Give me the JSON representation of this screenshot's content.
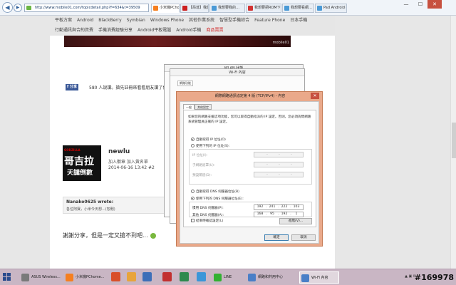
{
  "browser": {
    "url": "http://www.mobile01.com/topicdetail.php?f=634&t=39509",
    "back_glyph": "◀",
    "forward_glyph": "▶",
    "tabs": [
      {
        "label": "小米機PChome生…",
        "color": "#f57f20",
        "active": true
      },
      {
        "label": "【昂達】我能…",
        "color": "#cc2020",
        "active": false
      },
      {
        "label": "我想要我的…",
        "color": "#4a9ad6",
        "active": false
      },
      {
        "label": "我想要把ROM下…",
        "color": "#d23232",
        "active": false
      },
      {
        "label": "我想要看網…",
        "color": "#4a9ad6",
        "active": false
      },
      {
        "label": "Pad Android 點…",
        "color": "#4a9ad6",
        "active": false
      }
    ],
    "minimize": "—",
    "maximize": "☐",
    "close": "✕"
  },
  "site": {
    "menu_row1": [
      "平板方案",
      "Android",
      "BlackBerry",
      "Symbian",
      "Windows Phone",
      "其他作業系統",
      "智慧型手機綜合",
      "Feature Phone",
      "日本手機"
    ],
    "menu_row2": [
      "行動通訊與合約資費",
      "手機消費經驗分享",
      "Android平板電腦",
      "Android手機",
      "商品賣賣"
    ],
    "banner_caption": "mobile01",
    "fb_label": "f 分享",
    "fb_text": "580 人說讚。搶先註冊來看看朋友讚了什麼。",
    "post": {
      "avatar_small": "GODZILLA",
      "avatar_big": "哥吉拉",
      "avatar_sub": "天譴倒數",
      "username": "newlu",
      "meta": "加入徽章   加入黃名單",
      "date": "2014-06-16 13:42   #2"
    },
    "quote": {
      "author": "Nanako0625 wrote:",
      "text": "各位阿寶，小米今天想...(恕刪)"
    },
    "reply": "謝謝分享，但是一定又搶不到吧..."
  },
  "dialogs": {
    "bg_back_title": "WLAN 狀態",
    "wifi_title": "Wi-Fi 內容",
    "wifi_tab": "網路功能",
    "main": {
      "title": "網際網路通訊協定第 4 版 (TCP/IPv4) - 內容",
      "close": "✕",
      "tab_general": "一般",
      "tab_alternate": "其他設定",
      "description": "如果您的網路支援這項功能，您可以取得自動指派的 IP 設定。否則，您必須詢問網路系統管理員正確的 IP 設定。",
      "auto_ip": "自動取得 IP 位址(O)",
      "manual_ip": "使用下列的 IP 位址(S):",
      "ip_label": "IP 位址(I):",
      "subnet_label": "子網路遮罩(U):",
      "gateway_label": "預設閘道(D):",
      "auto_dns": "自動取得 DNS 伺服器位址(B)",
      "manual_dns": "使用下列的 DNS 伺服器位址(E):",
      "preferred_dns_label": "慣用 DNS 伺服器(P):",
      "preferred_dns": [
        "192",
        "241",
        "222",
        "103"
      ],
      "alternate_dns_label": "其他 DNS 伺服器(A):",
      "alternate_dns": [
        "168",
        "95",
        "192",
        "1"
      ],
      "validate_label": "結束時確認設定(L)",
      "advanced_button": "進階(V)...",
      "ok_button": "確定",
      "cancel_button": "取消"
    }
  },
  "taskbar": {
    "items": [
      {
        "label": "ASUS Wireless...",
        "color": "#7a7a7a",
        "active": false
      },
      {
        "label": "小米機PChome...",
        "color": "#f57f20",
        "active": false
      },
      {
        "label": "",
        "color": "#d94f2a",
        "active": false
      },
      {
        "label": "",
        "color": "#e8a43a",
        "active": false
      },
      {
        "label": "",
        "color": "#3d6fb8",
        "active": false
      },
      {
        "label": "",
        "color": "#c23030",
        "active": false
      },
      {
        "label": "",
        "color": "#2d8a4e",
        "active": false
      },
      {
        "label": "",
        "color": "#3a96d8",
        "active": false
      },
      {
        "label": "LINE",
        "color": "#32b132",
        "active": false
      },
      {
        "label": "網路和共用中心",
        "color": "#4a7fc7",
        "active": false
      },
      {
        "label": "Wi-Fi 內容",
        "color": "#4a7fc7",
        "active": true
      }
    ],
    "tray_text": "▲ ▣ ✉",
    "watermark": "#169978"
  }
}
